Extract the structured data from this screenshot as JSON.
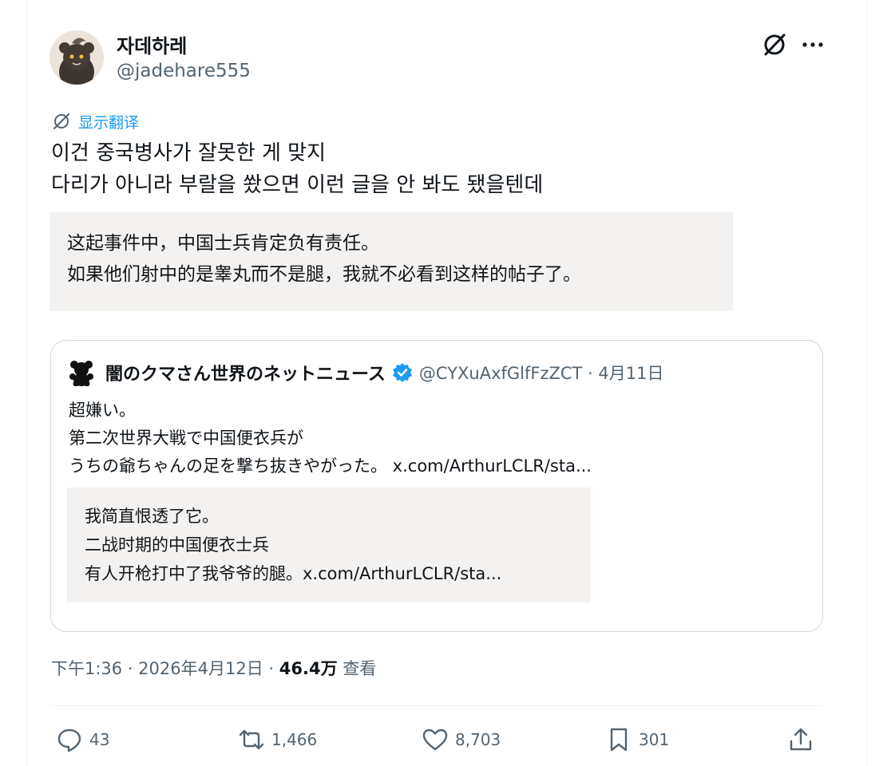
{
  "author": {
    "display_name": "자데하레",
    "handle": "@jadehare555"
  },
  "icons": {
    "grok": "grok-icon",
    "more": "more-options-icon",
    "translate": "translate-icon",
    "verified": "verified-badge-icon",
    "bear": "bear-emoji-icon"
  },
  "translate_link": "显示翻译",
  "tweet_text": "이건 중국병사가 잘못한 게 맞지\n다리가 아니라 부랄을 쐈으면 이런 글을 안 봐도 됐을텐데",
  "translation_text": "这起事件中，中国士兵肯定负有责任。\n如果他们射中的是睾丸而不是腿，我就不必看到这样的帖子了。",
  "quoted_tweet": {
    "display_name": "闇のクマさん世界のネットニュース",
    "handle_and_date": "@CYXuAxfGlfFzZCT · 4月11日",
    "text": "超嫌い。\n第二次世界大戦で中国便衣兵が\nうちの爺ちゃんの足を撃ち抜きやがった。 x.com/ArthurLCLR/sta...",
    "translation_text": "我简直恨透了它。\n二战时期的中国便衣士兵\n有人开枪打中了我爷爷的腿。x.com/ArthurLCLR/sta..."
  },
  "meta": {
    "time_date": "下午1:36 · 2026年4月12日 · ",
    "views_count": "46.4万",
    "views_label": " 查看"
  },
  "actions": {
    "replies": "43",
    "reposts": "1,466",
    "likes": "8,703",
    "bookmarks": "301"
  },
  "colors": {
    "accent": "#1d9bf0",
    "secondary_text": "#536471",
    "translation_bg": "#f4f2f0"
  }
}
